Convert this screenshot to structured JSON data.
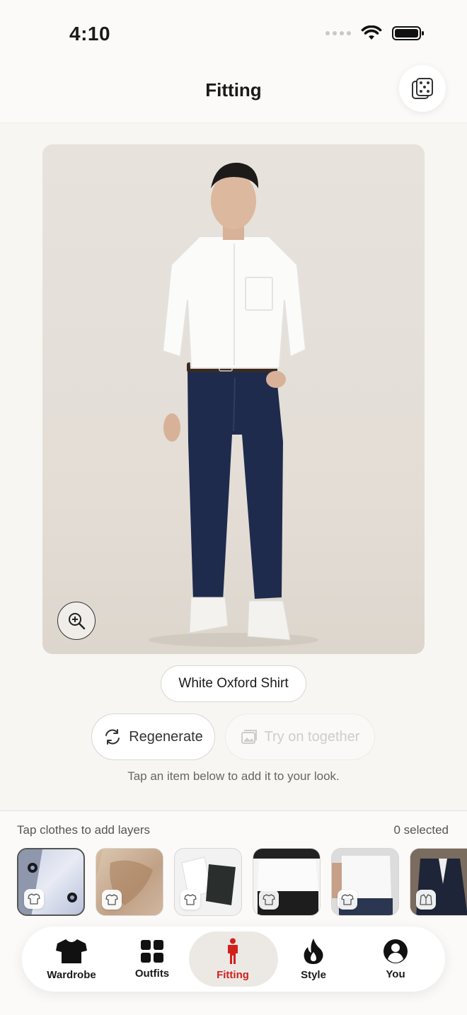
{
  "status": {
    "time": "4:10"
  },
  "header": {
    "title": "Fitting",
    "dice_icon": "dice-icon"
  },
  "preview": {
    "zoom_icon": "zoom-in-icon",
    "item_label": "White Oxford Shirt"
  },
  "actions": {
    "regenerate": "Regenerate",
    "try_together": "Try on together"
  },
  "hint": "Tap an item below to add it to your look.",
  "tray": {
    "label": "Tap clothes to add layers",
    "count": "0 selected",
    "items": [
      {
        "icon": "tshirt-icon"
      },
      {
        "icon": "tshirt-icon"
      },
      {
        "icon": "tshirt-icon"
      },
      {
        "icon": "tshirt-icon"
      },
      {
        "icon": "tshirt-icon"
      },
      {
        "icon": "jacket-icon"
      }
    ]
  },
  "tabs": [
    {
      "label": "Wardrobe",
      "icon": "tshirt-icon"
    },
    {
      "label": "Outfits",
      "icon": "grid-icon"
    },
    {
      "label": "Fitting",
      "icon": "person-icon",
      "active": true
    },
    {
      "label": "Style",
      "icon": "flame-icon"
    },
    {
      "label": "You",
      "icon": "profile-icon"
    }
  ],
  "colors": {
    "accent": "#d2201d",
    "background": "#f7f6f3"
  }
}
